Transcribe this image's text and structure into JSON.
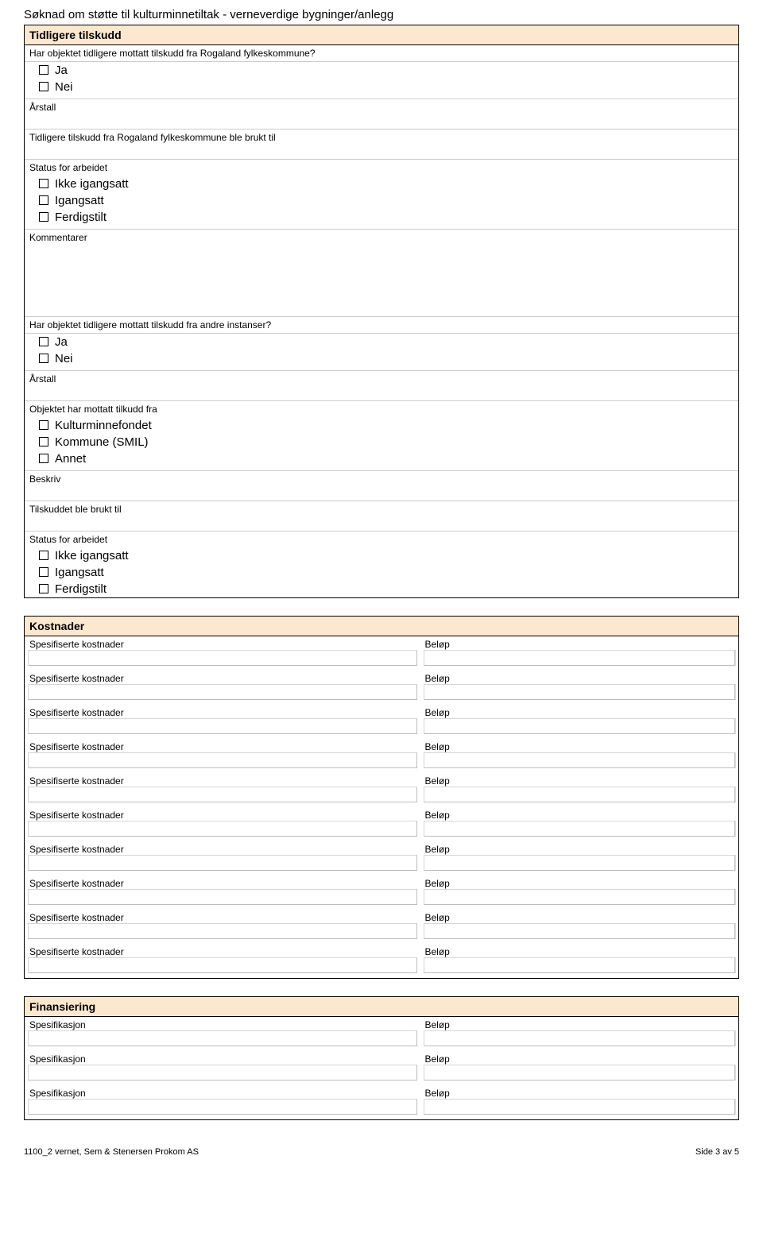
{
  "doc_title": "Søknad om støtte til kulturminnetiltak - verneverdige bygninger/anlegg",
  "section_tidligere": {
    "title": "Tidligere tilskudd",
    "q1": "Har objektet tidligere mottatt tilskudd fra Rogaland fylkeskommune?",
    "ja": "Ja",
    "nei": "Nei",
    "arstall": "Årstall",
    "brukt_til": "Tidligere tilskudd fra Rogaland fylkeskommune ble brukt til",
    "status_label": "Status for arbeidet",
    "status_opts": [
      "Ikke igangsatt",
      "Igangsatt",
      "Ferdigstilt"
    ],
    "kommentarer": "Kommentarer",
    "q2": "Har objektet tidligere mottatt tilskudd fra andre instanser?",
    "mottatt_fra_label": "Objektet har mottatt tilkudd fra",
    "mottatt_fra_opts": [
      "Kulturminnefondet",
      "Kommune (SMIL)",
      "Annet"
    ],
    "beskriv": "Beskriv",
    "tilskuddet_brukt": "Tilskuddet ble brukt til"
  },
  "section_kostnader": {
    "title": "Kostnader",
    "rows": [
      {
        "left": "Spesifiserte kostnader",
        "right": "Beløp"
      },
      {
        "left": "Spesifiserte kostnader",
        "right": "Beløp"
      },
      {
        "left": "Spesifiserte kostnader",
        "right": "Beløp"
      },
      {
        "left": "Spesifiserte kostnader",
        "right": "Beløp"
      },
      {
        "left": "Spesifiserte kostnader",
        "right": "Beløp"
      },
      {
        "left": "Spesifiserte kostnader",
        "right": "Beløp"
      },
      {
        "left": "Spesifiserte kostnader",
        "right": "Beløp"
      },
      {
        "left": "Spesifiserte kostnader",
        "right": "Beløp"
      },
      {
        "left": "Spesifiserte kostnader",
        "right": "Beløp"
      },
      {
        "left": "Spesifiserte kostnader",
        "right": "Beløp"
      }
    ]
  },
  "section_finansiering": {
    "title": "Finansiering",
    "rows": [
      {
        "left": "Spesifikasjon",
        "right": "Beløp"
      },
      {
        "left": "Spesifikasjon",
        "right": "Beløp"
      },
      {
        "left": "Spesifikasjon",
        "right": "Beløp"
      }
    ]
  },
  "footer": {
    "left": "1100_2 vernet, Sem & Stenersen Prokom AS",
    "right": "Side 3 av 5"
  }
}
